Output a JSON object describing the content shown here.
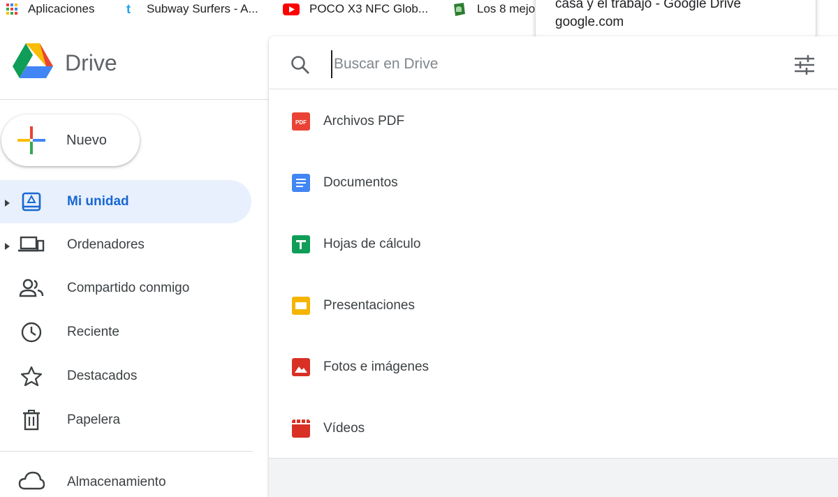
{
  "bookmarks": [
    {
      "label": "Aplicaciones",
      "icon": "apps-grid-icon"
    },
    {
      "label": "Subway Surfers - A...",
      "icon": "tumblr-icon"
    },
    {
      "label": "POCO X3 NFC Glob...",
      "icon": "youtube-icon"
    },
    {
      "label": "Los 8 mejo",
      "icon": "android-icon"
    }
  ],
  "tooltip": {
    "line1": "casa y el trabajo - Google Drive",
    "line2": "google.com"
  },
  "logo": {
    "text": "Drive"
  },
  "new_button": {
    "label": "Nuevo"
  },
  "sidebar": {
    "items": [
      {
        "label": "Mi unidad",
        "icon": "my-drive-icon",
        "active": true,
        "expandable": true
      },
      {
        "label": "Ordenadores",
        "icon": "computers-icon",
        "active": false,
        "expandable": true
      },
      {
        "label": "Compartido conmigo",
        "icon": "shared-people-icon",
        "active": false,
        "expandable": false
      },
      {
        "label": "Reciente",
        "icon": "clock-icon",
        "active": false,
        "expandable": false
      },
      {
        "label": "Destacados",
        "icon": "star-icon",
        "active": false,
        "expandable": false
      },
      {
        "label": "Papelera",
        "icon": "trash-icon",
        "active": false,
        "expandable": false
      }
    ],
    "storage_label": "Almacenamiento"
  },
  "search": {
    "placeholder": "Buscar en Drive",
    "value": ""
  },
  "file_types": [
    {
      "label": "Archivos PDF",
      "icon": "pdf-icon",
      "color": "#ea4335"
    },
    {
      "label": "Documentos",
      "icon": "docs-icon",
      "color": "#4285f4"
    },
    {
      "label": "Hojas de cálculo",
      "icon": "sheets-icon",
      "color": "#0f9d58"
    },
    {
      "label": "Presentaciones",
      "icon": "slides-icon",
      "color": "#f4b400"
    },
    {
      "label": "Fotos e imágenes",
      "icon": "image-icon",
      "color": "#d93025"
    },
    {
      "label": "Vídeos",
      "icon": "video-icon",
      "color": "#d93025"
    }
  ],
  "colors": {
    "accent": "#1967d2",
    "active_bg": "#e8f0fe"
  }
}
